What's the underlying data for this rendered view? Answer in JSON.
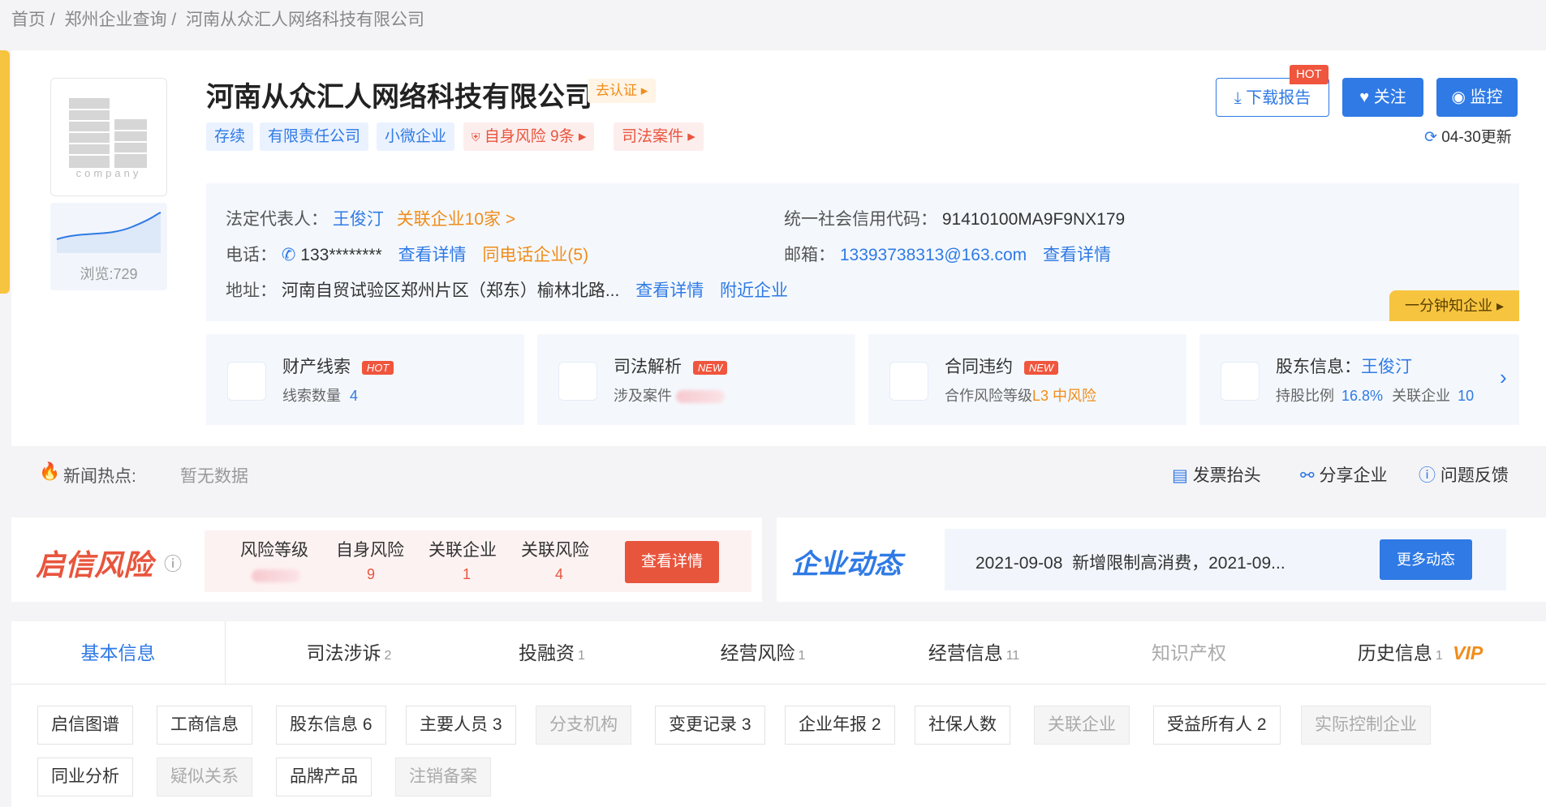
{
  "breadcrumb": [
    "首页 /",
    "郑州企业查询 /",
    "河南从众汇人网络科技有限公司"
  ],
  "company": {
    "name": "河南从众汇人网络科技有限公司",
    "verify": "去认证 ▸",
    "logo_caption": "company",
    "views": "浏览:729",
    "tags": [
      "存续",
      "有限责任公司",
      "小微企业"
    ],
    "risk_tag": "自身风险 9条 ▸",
    "judicial_tag": "司法案件 ▸"
  },
  "actions": {
    "download": "下载报告",
    "hot": "HOT",
    "follow": "关注",
    "monitor": "监控",
    "updated": "04-30更新"
  },
  "info": {
    "legal_rep_label": "法定代表人：",
    "legal_rep": "王俊汀",
    "related": "关联企业10家 >",
    "credit_label": "统一社会信用代码：",
    "credit_code": "91410100MA9F9NX179",
    "phone_label": "电话：",
    "phone": "133********",
    "phone_detail": "查看详情",
    "same_phone": "同电话企业(5)",
    "email_label": "邮箱：",
    "email": "13393738313@163.com",
    "email_detail": "查看详情",
    "address_label": "地址：",
    "address": "河南自贸试验区郑州片区（郑东）榆林北路...",
    "address_detail": "查看详情",
    "nearby": "附近企业",
    "one_min": "一分钟知企业 ▸"
  },
  "mini_cards": [
    {
      "title": "财产线索",
      "badge": "HOT",
      "sub_label": "线索数量",
      "sub_value": "4"
    },
    {
      "title": "司法解析",
      "badge": "NEW",
      "sub_label": "涉及案件",
      "sub_value": ""
    },
    {
      "title": "合同违约",
      "badge": "NEW",
      "sub_label": "合作风险等级",
      "sub_value": "L3 中风险"
    },
    {
      "title": "股东信息：",
      "title_link": "王俊汀",
      "sub_label": "持股比例",
      "sub_value": "16.8%",
      "sub_label2": "关联企业",
      "sub_value2": "10"
    }
  ],
  "news": {
    "label": "新闻热点:",
    "value": "暂无数据",
    "invoice": "发票抬头",
    "share": "分享企业",
    "feedback": "问题反馈"
  },
  "risk": {
    "logo": "启信风险",
    "cols": [
      {
        "label": "风险等级",
        "value": ""
      },
      {
        "label": "自身风险",
        "value": "9"
      },
      {
        "label": "关联企业",
        "value": "1"
      },
      {
        "label": "关联风险",
        "value": "4"
      }
    ],
    "detail_btn": "查看详情"
  },
  "dynamics": {
    "logo": "企业动态",
    "text": "2021-09-08  新增限制高消费，2021-09...",
    "more": "更多动态"
  },
  "tabs": [
    {
      "label": "基本信息",
      "count": ""
    },
    {
      "label": "司法涉诉",
      "count": "2"
    },
    {
      "label": "投融资",
      "count": "1"
    },
    {
      "label": "经营风险",
      "count": "1"
    },
    {
      "label": "经营信息",
      "count": "11"
    },
    {
      "label": "知识产权",
      "count": ""
    },
    {
      "label": "历史信息",
      "count": "1",
      "vip": "VIP"
    }
  ],
  "chips": [
    "启信图谱",
    "工商信息",
    "股东信息 6",
    "主要人员 3",
    "分支机构",
    "变更记录 3",
    "企业年报 2",
    "社保人数",
    "关联企业",
    "受益所有人 2",
    "实际控制企业",
    "同业分析",
    "疑似关系",
    "品牌产品",
    "注销备案"
  ],
  "colors": {
    "accent": "#2f7ae5",
    "risk": "#e8553d",
    "warn": "#f08c1b",
    "yellow": "#f7c440"
  }
}
